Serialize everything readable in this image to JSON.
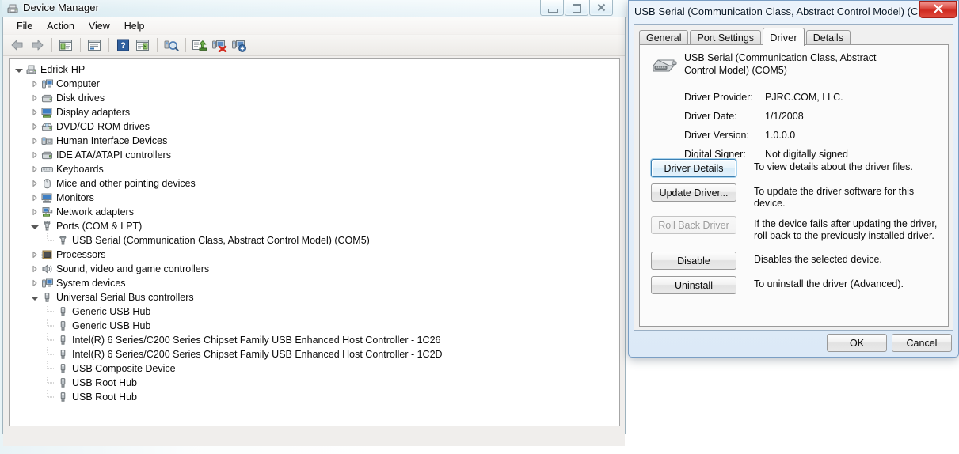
{
  "device_manager": {
    "title": "Device Manager",
    "title_icon": "device-manager-icon",
    "caption_buttons": [
      {
        "name": "minimize",
        "glyph": "—"
      },
      {
        "name": "maximize",
        "glyph": "□"
      },
      {
        "name": "close",
        "glyph": "✕"
      }
    ],
    "menu": [
      "File",
      "Action",
      "View",
      "Help"
    ],
    "toolbar": [
      {
        "name": "back-icon",
        "kind": "arrow-left"
      },
      {
        "name": "forward-icon",
        "kind": "arrow-right"
      },
      {
        "name": "separator",
        "kind": "sep"
      },
      {
        "name": "show-hide-console-tree-icon",
        "kind": "tree"
      },
      {
        "name": "separator",
        "kind": "sep"
      },
      {
        "name": "properties-icon",
        "kind": "props"
      },
      {
        "name": "separator",
        "kind": "sep"
      },
      {
        "name": "help-icon",
        "kind": "help"
      },
      {
        "name": "show-action-pane-icon",
        "kind": "action"
      },
      {
        "name": "separator",
        "kind": "sep"
      },
      {
        "name": "scan-for-hardware-changes-icon",
        "kind": "scan"
      },
      {
        "name": "separator",
        "kind": "sep"
      },
      {
        "name": "update-driver-software-icon",
        "kind": "update"
      },
      {
        "name": "uninstall-device-icon",
        "kind": "uninstall"
      },
      {
        "name": "disable-device-icon",
        "kind": "disable"
      }
    ],
    "tree": [
      {
        "label": "Edrick-HP",
        "depth": 0,
        "state": "expanded",
        "icon": "computer-root-icon"
      },
      {
        "label": "Computer",
        "depth": 1,
        "state": "collapsed",
        "icon": "computer-icon"
      },
      {
        "label": "Disk drives",
        "depth": 1,
        "state": "collapsed",
        "icon": "disk-icon"
      },
      {
        "label": "Display adapters",
        "depth": 1,
        "state": "collapsed",
        "icon": "display-icon"
      },
      {
        "label": "DVD/CD-ROM drives",
        "depth": 1,
        "state": "collapsed",
        "icon": "dvd-icon"
      },
      {
        "label": "Human Interface Devices",
        "depth": 1,
        "state": "collapsed",
        "icon": "hid-icon"
      },
      {
        "label": "IDE ATA/ATAPI controllers",
        "depth": 1,
        "state": "collapsed",
        "icon": "ide-icon"
      },
      {
        "label": "Keyboards",
        "depth": 1,
        "state": "collapsed",
        "icon": "keyboard-icon"
      },
      {
        "label": "Mice and other pointing devices",
        "depth": 1,
        "state": "collapsed",
        "icon": "mouse-icon"
      },
      {
        "label": "Monitors",
        "depth": 1,
        "state": "collapsed",
        "icon": "monitor-icon"
      },
      {
        "label": "Network adapters",
        "depth": 1,
        "state": "collapsed",
        "icon": "network-icon"
      },
      {
        "label": "Ports (COM & LPT)",
        "depth": 1,
        "state": "expanded",
        "icon": "port-icon"
      },
      {
        "label": "USB Serial (Communication Class, Abstract Control Model) (COM5)",
        "depth": 2,
        "state": "leaf",
        "icon": "port-icon"
      },
      {
        "label": "Processors",
        "depth": 1,
        "state": "collapsed",
        "icon": "processor-icon"
      },
      {
        "label": "Sound, video and game controllers",
        "depth": 1,
        "state": "collapsed",
        "icon": "sound-icon"
      },
      {
        "label": "System devices",
        "depth": 1,
        "state": "collapsed",
        "icon": "system-icon"
      },
      {
        "label": "Universal Serial Bus controllers",
        "depth": 1,
        "state": "expanded",
        "icon": "usb-icon"
      },
      {
        "label": "Generic USB Hub",
        "depth": 2,
        "state": "leaf",
        "icon": "usb-icon"
      },
      {
        "label": "Generic USB Hub",
        "depth": 2,
        "state": "leaf",
        "icon": "usb-icon"
      },
      {
        "label": "Intel(R) 6 Series/C200 Series Chipset Family USB Enhanced Host Controller - 1C26",
        "depth": 2,
        "state": "leaf",
        "icon": "usb-icon"
      },
      {
        "label": "Intel(R) 6 Series/C200 Series Chipset Family USB Enhanced Host Controller - 1C2D",
        "depth": 2,
        "state": "leaf",
        "icon": "usb-icon"
      },
      {
        "label": "USB Composite Device",
        "depth": 2,
        "state": "leaf",
        "icon": "usb-icon"
      },
      {
        "label": "USB Root Hub",
        "depth": 2,
        "state": "leaf",
        "icon": "usb-icon"
      },
      {
        "label": "USB Root Hub",
        "depth": 2,
        "state": "leaf",
        "icon": "usb-icon"
      }
    ],
    "status_bar": [
      "",
      "",
      ""
    ]
  },
  "dialog": {
    "title": "USB Serial (Communication Class, Abstract Control Model) (COM...",
    "close_glyph": "✕",
    "tabs": [
      {
        "label": "General",
        "active": false
      },
      {
        "label": "Port Settings",
        "active": false
      },
      {
        "label": "Driver",
        "active": true
      },
      {
        "label": "Details",
        "active": false
      }
    ],
    "device_name": "USB Serial (Communication Class, Abstract Control Model) (COM5)",
    "device_icon": "serial-port-device-icon",
    "properties": [
      {
        "label": "Driver Provider:",
        "value": "PJRC.COM, LLC."
      },
      {
        "label": "Driver Date:",
        "value": "1/1/2008"
      },
      {
        "label": "Driver Version:",
        "value": "1.0.0.0"
      },
      {
        "label": "Digital Signer:",
        "value": "Not digitally signed"
      }
    ],
    "actions": [
      {
        "button": "Driver Details",
        "description": "To view details about the driver files.",
        "state": "focused"
      },
      {
        "button": "Update Driver...",
        "description": "To update the driver software for this device.",
        "state": "normal"
      },
      {
        "button": "Roll Back Driver",
        "description": "If the device fails after updating the driver, roll back to the previously installed driver.",
        "state": "disabled"
      },
      {
        "button": "Disable",
        "description": "Disables the selected device.",
        "state": "normal"
      },
      {
        "button": "Uninstall",
        "description": "To uninstall the driver (Advanced).",
        "state": "normal"
      }
    ],
    "footer": {
      "ok": "OK",
      "cancel": "Cancel"
    }
  },
  "colors": {
    "accent_focus": "#3c7fb1",
    "close_red": "#cf2a20",
    "window_chrome": "#f0eeec",
    "tree_bg": "#ffffff"
  }
}
